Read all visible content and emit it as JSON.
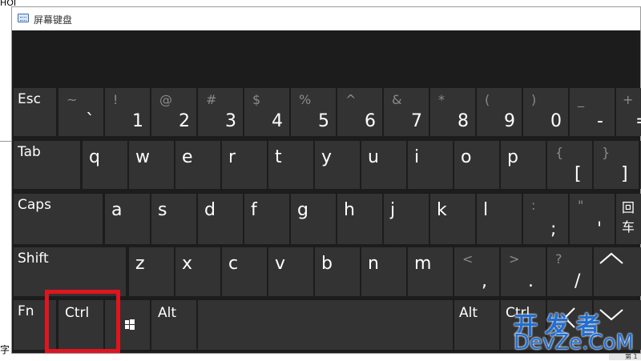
{
  "background": {
    "top_text": "HOI",
    "status_left": "字",
    "status_right": "第 1"
  },
  "window": {
    "title": "屏幕键盘",
    "icon": "keyboard-icon"
  },
  "keyboard": {
    "row1": [
      {
        "label": "Esc"
      },
      {
        "sec": "~",
        "pri": "`"
      },
      {
        "sec": "!",
        "pri": "1"
      },
      {
        "sec": "@",
        "pri": "2"
      },
      {
        "sec": "#",
        "pri": "3"
      },
      {
        "sec": "$",
        "pri": "4"
      },
      {
        "sec": "%",
        "pri": "5"
      },
      {
        "sec": "^",
        "pri": "6"
      },
      {
        "sec": "&",
        "pri": "7"
      },
      {
        "sec": "*",
        "pri": "8"
      },
      {
        "sec": "(",
        "pri": "9"
      },
      {
        "sec": ")",
        "pri": "0"
      },
      {
        "sec": "_",
        "pri": "-"
      },
      {
        "sec": "+",
        "pri": "="
      }
    ],
    "row2": [
      {
        "label": "Tab"
      },
      {
        "ch": "q"
      },
      {
        "ch": "w"
      },
      {
        "ch": "e"
      },
      {
        "ch": "r"
      },
      {
        "ch": "t"
      },
      {
        "ch": "y"
      },
      {
        "ch": "u"
      },
      {
        "ch": "i"
      },
      {
        "ch": "o"
      },
      {
        "ch": "p"
      },
      {
        "sec": "{",
        "pri": "["
      },
      {
        "sec": "}",
        "pri": "]"
      },
      {
        "sec": "|",
        "pri": "\\"
      }
    ],
    "row3": [
      {
        "label": "Caps"
      },
      {
        "ch": "a"
      },
      {
        "ch": "s"
      },
      {
        "ch": "d"
      },
      {
        "ch": "f"
      },
      {
        "ch": "g"
      },
      {
        "ch": "h"
      },
      {
        "ch": "j"
      },
      {
        "ch": "k"
      },
      {
        "ch": "l"
      },
      {
        "sec": ":",
        "pri": ";"
      },
      {
        "sec": "\"",
        "pri": "'"
      },
      {
        "label": "回车"
      }
    ],
    "row4": [
      {
        "label": "Shift"
      },
      {
        "ch": "z"
      },
      {
        "ch": "x"
      },
      {
        "ch": "c"
      },
      {
        "ch": "v"
      },
      {
        "ch": "b"
      },
      {
        "ch": "n"
      },
      {
        "ch": "m"
      },
      {
        "sec": "<",
        "pri": ","
      },
      {
        "sec": ">",
        "pri": "."
      },
      {
        "sec": "?",
        "pri": "/"
      },
      {
        "icon": "up-arrow-icon"
      }
    ],
    "row5": [
      {
        "label": "Fn"
      },
      {
        "label": "Ctrl"
      },
      {
        "icon": "windows-icon"
      },
      {
        "label": "Alt"
      },
      {
        "label": ""
      },
      {
        "label": "Alt"
      },
      {
        "label": "Ctrl"
      },
      {
        "icon": "left-arrow-icon"
      },
      {
        "icon": "down-arrow-icon"
      }
    ]
  },
  "highlight": {
    "color": "#e0151f",
    "target": "Ctrl"
  },
  "watermark": {
    "line1": "开发者",
    "line2": "DevZe.CoM",
    "color": "#1f6fd6"
  }
}
